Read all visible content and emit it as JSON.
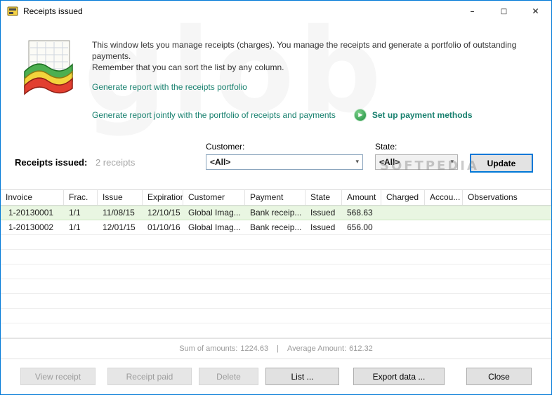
{
  "window": {
    "title": "Receipts issued"
  },
  "icons": {
    "minimize": "–",
    "maximize": "□",
    "close": "✕",
    "dropdown_chevron": "▾",
    "play": "▶"
  },
  "watermarks": {
    "background": "glob",
    "overlay": "SOFTPEDIA"
  },
  "intro": {
    "description_line1": "This window lets you manage receipts (charges). You manage the receipts and generate a portfolio of outstanding payments.",
    "description_line2": "Remember that you can sort the list by any column.",
    "link_report": "Generate report with the receipts portfolio",
    "link_report_joint": "Generate report jointly with the portfolio of receipts and payments",
    "link_setup_payment": "Set up payment methods"
  },
  "filters": {
    "label": "Receipts issued:",
    "count": "2 receipts",
    "customer_label": "Customer:",
    "customer_value": "<All>",
    "state_label": "State:",
    "state_value": "<All>",
    "update_button": "Update"
  },
  "table": {
    "columns": [
      "Invoice",
      "Frac.",
      "Issue",
      "Expiration",
      "Customer",
      "Payment",
      "State",
      "Amount",
      "Charged",
      "Accou...",
      "Observations"
    ],
    "rows": [
      [
        "1-20130001",
        "1/1",
        "11/08/15",
        "12/10/15",
        "Global Imag...",
        "Bank receip...",
        "Issued",
        "568.63",
        "",
        "",
        ""
      ],
      [
        "1-20130002",
        "1/1",
        "12/01/15",
        "01/10/16",
        "Global Imag...",
        "Bank receip...",
        "Issued",
        "656.00",
        "",
        "",
        ""
      ]
    ]
  },
  "status": {
    "sum_label": "Sum of amounts:",
    "sum_value": "1224.63",
    "separator": "|",
    "avg_label": "Average Amount:",
    "avg_value": "612.32"
  },
  "actions": {
    "view_receipt": "View receipt",
    "receipt_paid": "Receipt paid",
    "delete": "Delete",
    "list": "List ...",
    "export": "Export data ...",
    "close": "Close"
  },
  "colors": {
    "accent": "#0078d7",
    "link": "#17806e",
    "selected_row": "#e9f6e2",
    "play_green": "#1d8f3f"
  }
}
